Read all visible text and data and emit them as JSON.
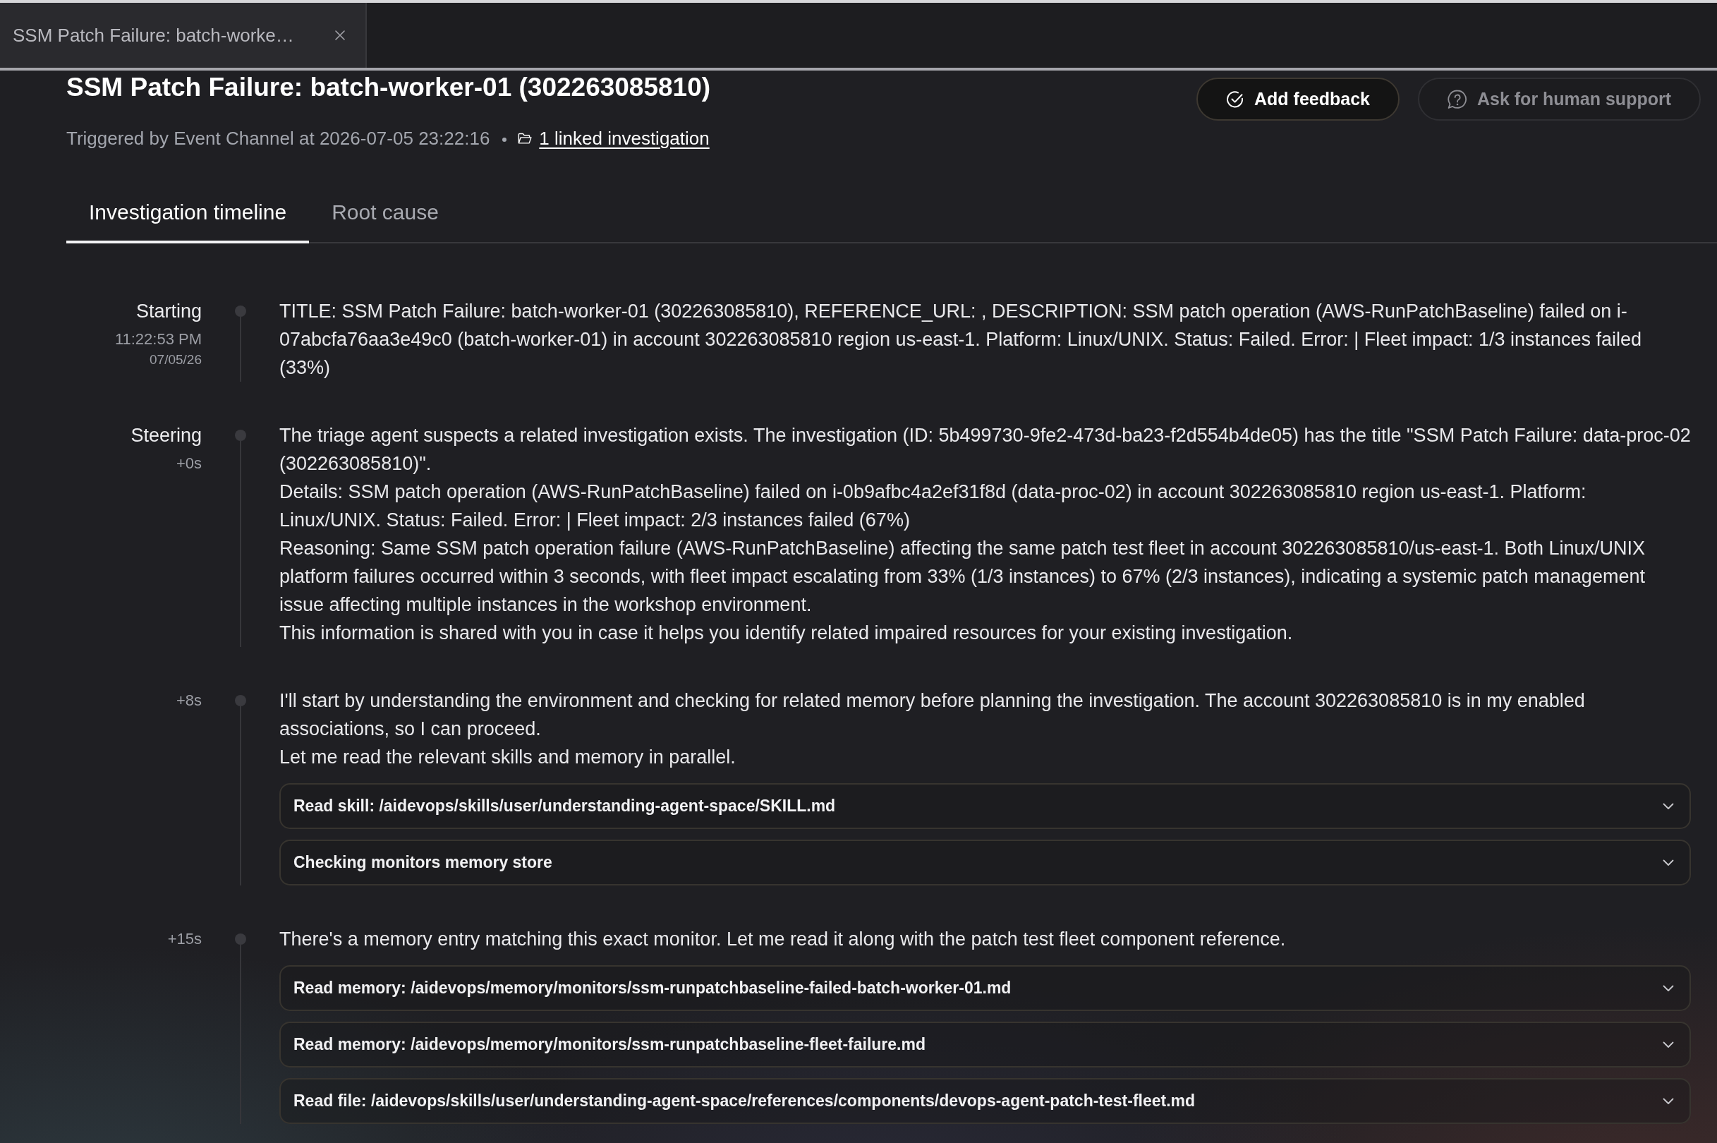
{
  "tab_bar": {
    "tabs": [
      {
        "label": "SSM Patch Failure: batch-worke…",
        "selected": true
      }
    ]
  },
  "header": {
    "title": "SSM Patch Failure: batch-worker-01 (302263085810)",
    "trigger_text": "Triggered by Event Channel at 2026-07-05 23:22:16",
    "linked_investigation": "1 linked investigation"
  },
  "actions": [
    {
      "kind": "feedback",
      "label": "Add feedback",
      "disabled": false
    },
    {
      "kind": "support",
      "label": "Ask for human support",
      "disabled": true
    }
  ],
  "tabs": [
    {
      "label": "Investigation timeline",
      "selected": true
    },
    {
      "label": "Root cause",
      "selected": false
    }
  ],
  "timeline": [
    {
      "label": "Starting",
      "time": "11:22:53 PM",
      "date": "07/05/26",
      "paragraphs": [
        "TITLE: SSM Patch Failure: batch-worker-01 (302263085810), REFERENCE_URL: , DESCRIPTION: SSM patch operation (AWS-RunPatchBaseline) failed on i-07abcfa76aa3e49c0 (batch-worker-01) in account 302263085810 region us-east-1. Platform: Linux/UNIX. Status: Failed. Error: | Fleet impact: 1/3 instances failed (33%)"
      ]
    },
    {
      "label": "Steering",
      "time": "+0s",
      "paragraphs": [
        "The triage agent suspects a related investigation exists. The investigation (ID: 5b499730-9fe2-473d-ba23-f2d554b4de05) has the title \"SSM Patch Failure: data-proc-02 (302263085810)\".",
        "Details: SSM patch operation (AWS-RunPatchBaseline) failed on i-0b9afbc4a2ef31f8d (data-proc-02) in account 302263085810 region us-east-1. Platform: Linux/UNIX. Status: Failed. Error: | Fleet impact: 2/3 instances failed (67%)",
        "Reasoning: Same SSM patch operation failure (AWS-RunPatchBaseline) affecting the same patch test fleet in account 302263085810/us-east-1. Both Linux/UNIX platform failures occurred within 3 seconds, with fleet impact escalating from 33% (1/3 instances) to 67% (2/3 instances), indicating a systemic patch management issue affecting multiple instances in the workshop environment.",
        "This information is shared with you in case it helps you identify related impaired resources for your existing investigation."
      ]
    },
    {
      "time": "+8s",
      "paragraphs": [
        "I'll start by understanding the environment and checking for related memory before planning the investigation. The account 302263085810 is in my enabled associations, so I can proceed.",
        "Let me read the relevant skills and memory in parallel."
      ],
      "steps": [
        {
          "label": "Read skill: /aidevops/skills/user/understanding-agent-space/SKILL.md",
          "expanded": false
        },
        {
          "label": "Checking monitors memory store",
          "expanded": false
        }
      ]
    },
    {
      "time": "+15s",
      "paragraphs": [
        "There's a memory entry matching this exact monitor. Let me read it along with the patch test fleet component reference."
      ],
      "steps": [
        {
          "label": "Read memory: /aidevops/memory/monitors/ssm-runpatchbaseline-failed-batch-worker-01.md",
          "expanded": false
        },
        {
          "label": "Read memory: /aidevops/memory/monitors/ssm-runpatchbaseline-fleet-failure.md",
          "expanded": false
        },
        {
          "label": "Read file: /aidevops/skills/user/understanding-agent-space/references/components/devops-agent-patch-test-fleet.md",
          "expanded": false
        }
      ]
    }
  ]
}
